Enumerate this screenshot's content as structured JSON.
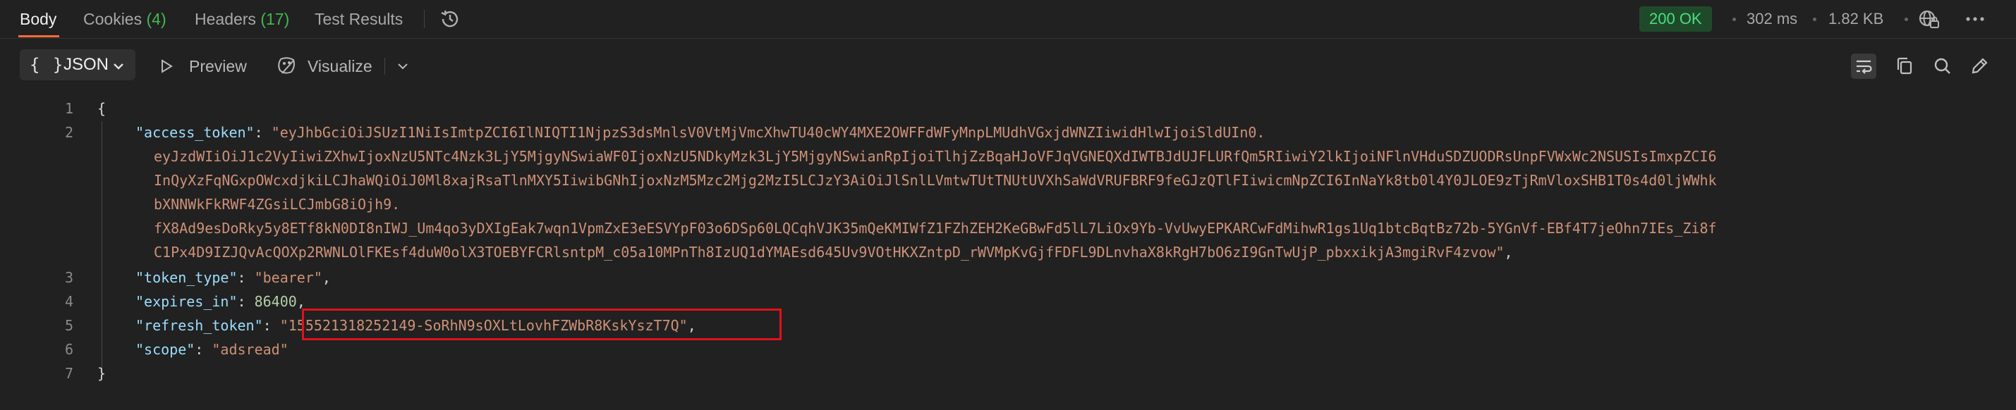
{
  "tabs": [
    {
      "label": "Body",
      "count": ""
    },
    {
      "label": "Cookies",
      "count": "(4)"
    },
    {
      "label": "Headers",
      "count": "(17)"
    },
    {
      "label": "Test Results",
      "count": ""
    }
  ],
  "status": {
    "code": "200 OK",
    "time": "302 ms",
    "size": "1.82 KB"
  },
  "toolbar": {
    "format_braces": "{ }",
    "format_label": "JSON",
    "preview_label": "Preview",
    "visualize_label": "Visualize"
  },
  "code": {
    "line_numbers": [
      "1",
      "2",
      "3",
      "4",
      "5",
      "6",
      "7"
    ],
    "open_brace": "{",
    "close_brace": "}",
    "access_token_key": "\"access_token\"",
    "access_token_lines": [
      "\"eyJhbGciOiJSUzI1NiIsImtpZCI6IlNIQTI1NjpzS3dsMnlsV0VtMjVmcXhwTU40cWY4MXE2OWFFdWFyMnpLMUdhVGxjdWNZIiwidHlwIjoiSldUIn0.",
      "eyJzdWIiOiJ1c2VyIiwiZXhwIjoxNzU5NTc4Nzk3LjY5MjgyNSwiaWF0IjoxNzU5NDkyMzk3LjY5MjgyNSwianRpIjoiTlhjZzBqaHJoVFJqVGNEQXdIWTBJdUJFLURfQm5RIiwiY2lkIjoiNFlnVHduSDZUODRsUnpFVWxWc2NSUSIsImxpZCI6",
      "InQyXzFqNGxpOWcxdjkiLCJhaWQiOiJ0Ml8xajRsaTlnMXY5IiwibGNhIjoxNzM5Mzc2Mjg2MzI5LCJzY3AiOiJlSnlLVmtwTUtTNUtUVXhSaWdVRUFBRF9feGJzQTlFIiwicmNpZCI6InNaYk8tb0l4Y0JLOE9zTjRmVloxSHB1T0s4d0ljWWhk",
      "bXNNWkFkRWF4ZGsiLCJmbG8iOjh9.",
      "fX8Ad9esDoRky5y8ETf8kN0DI8nIWJ_Um4qo3yDXIgEak7wqn1VpmZxE3eESVYpF03o6DSp60LQCqhVJK35mQeKMIWfZ1FZhZEH2KeGBwFd5lL7LiOx9Yb-VvUwyEPKARCwFdMihwR1gs1Uq1btcBqtBz72b-5YGnVf-EBf4T7jeOhn7IEs_Zi8f",
      "C1Px4D9IZJQvAcQOXp2RWNLOlFKEsf4duW0olX3TOEBYFCRlsntpM_c05a10MPnTh8IzUQ1dYMAEsd645Uv9VOtHKXZntpD_rWVMpKvGjfFDFL9DLnvhaX8kRgH7bO6zI9GnTwUjP_pbxxikjA3mgiRvF4zvow\""
    ],
    "token_type_key": "\"token_type\"",
    "token_type_val": "\"bearer\"",
    "expires_in_key": "\"expires_in\"",
    "expires_in_val": "86400",
    "refresh_token_key": "\"refresh_token\"",
    "refresh_token_val": "\"155521318252149-SoRhN9sOXLtLovhFZWbR8KskYszT7Q\"",
    "scope_key": "\"scope\"",
    "scope_val": "\"adsread\"",
    "colon": ": ",
    "comma": ","
  },
  "colors": {
    "accent": "#ff6c37",
    "status_ok": "#4ade80",
    "json_key": "#9cdcfe",
    "json_string": "#ce9178",
    "json_number": "#b5cea8",
    "highlight_border": "#e0111b"
  },
  "icons": [
    "history-icon",
    "globe-icon",
    "more-icon",
    "chevron-down-icon",
    "preview-icon",
    "visualize-icon",
    "wrap-lines-icon",
    "copy-icon",
    "search-icon",
    "edit-icon"
  ]
}
